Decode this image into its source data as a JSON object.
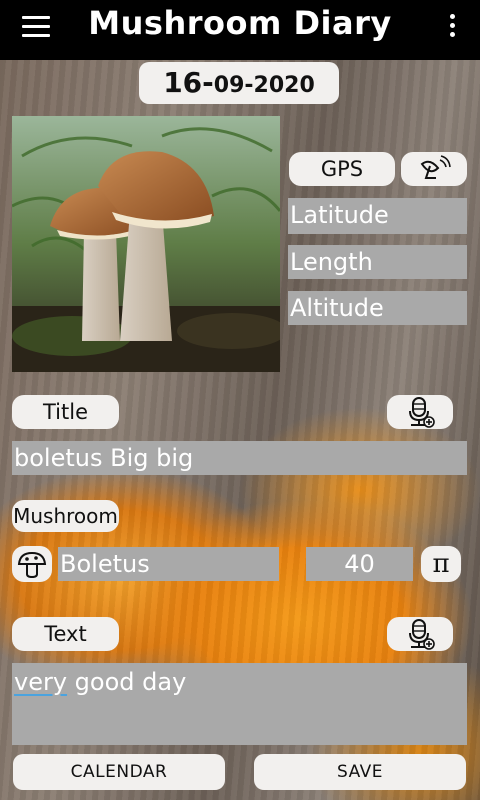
{
  "app": {
    "title": "Mushroom Diary"
  },
  "date": {
    "day": "16-",
    "month_year": "09-2020"
  },
  "gps": {
    "button_label": "GPS",
    "latitude_placeholder": "Latitude",
    "length_placeholder": "Length",
    "altitude_placeholder": "Altitude"
  },
  "title_section": {
    "label": "Title",
    "value": "boletus Big big"
  },
  "mushroom_section": {
    "label": "Mushroom",
    "name": "Boletus",
    "count": "40",
    "pi_symbol": "π"
  },
  "text_section": {
    "label": "Text",
    "value_first_word": "very",
    "value_rest": " good day"
  },
  "bottom": {
    "calendar_label": "CALENDAR",
    "save_label": "SAVE"
  },
  "icons": {
    "menu": "menu-icon",
    "more": "more-vert-icon",
    "satellite": "satellite-dish-icon",
    "mic_add": "microphone-add-icon",
    "mushroom": "mushroom-icon"
  }
}
